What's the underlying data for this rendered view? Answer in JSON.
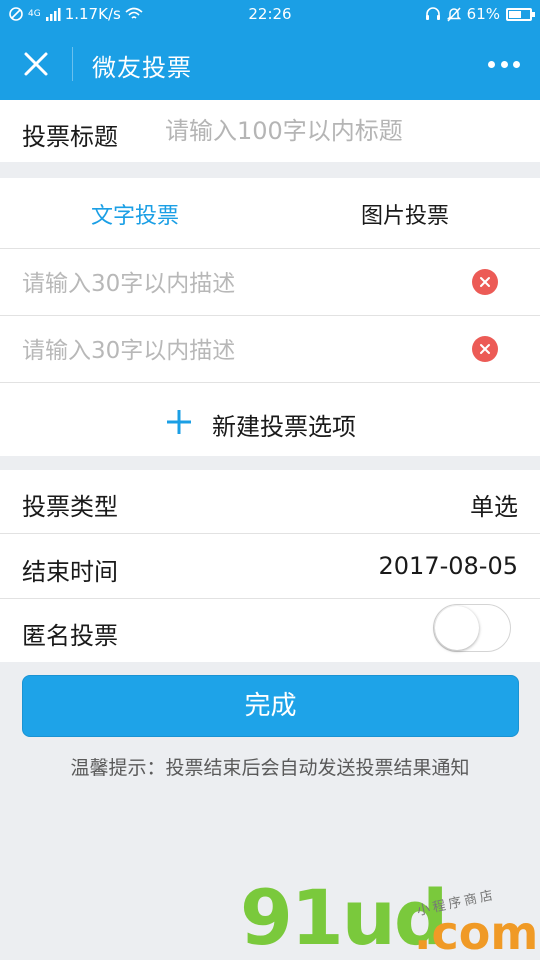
{
  "status_bar": {
    "signal_text": "4G",
    "speed": "1.17K/s",
    "time": "22:26",
    "battery": "61%",
    "battery_level": 0.61
  },
  "header": {
    "title": "微友投票",
    "close_icon": "close-icon",
    "more_icon": "more-icon"
  },
  "vote_title": {
    "label": "投票标题",
    "placeholder": "请输入100字以内标题",
    "value": ""
  },
  "vote_mode_tabs": [
    {
      "label": "文字投票",
      "active": true
    },
    {
      "label": "图片投票",
      "active": false
    }
  ],
  "options": [
    {
      "placeholder": "请输入30字以内描述",
      "value": ""
    },
    {
      "placeholder": "请输入30字以内描述",
      "value": ""
    }
  ],
  "add_option": {
    "label": "新建投票选项",
    "icon": "plus-icon"
  },
  "settings": {
    "type": {
      "label": "投票类型",
      "value": "单选"
    },
    "end_time": {
      "label": "结束时间",
      "value": "2017-08-05"
    },
    "anonymous": {
      "label": "匿名投票",
      "enabled": false
    }
  },
  "submit": {
    "label": "完成"
  },
  "hint": "温馨提示：投票结束后会自动发送投票结果通知",
  "watermark": {
    "brand": "91ud",
    "suffix": ".com",
    "tagline": "小程序商店"
  },
  "colors": {
    "accent": "#1b9fe5",
    "delete": "#ec5b56",
    "background": "#eceef1",
    "watermark_green": "#7ac93c",
    "watermark_orange": "#f09a26"
  }
}
